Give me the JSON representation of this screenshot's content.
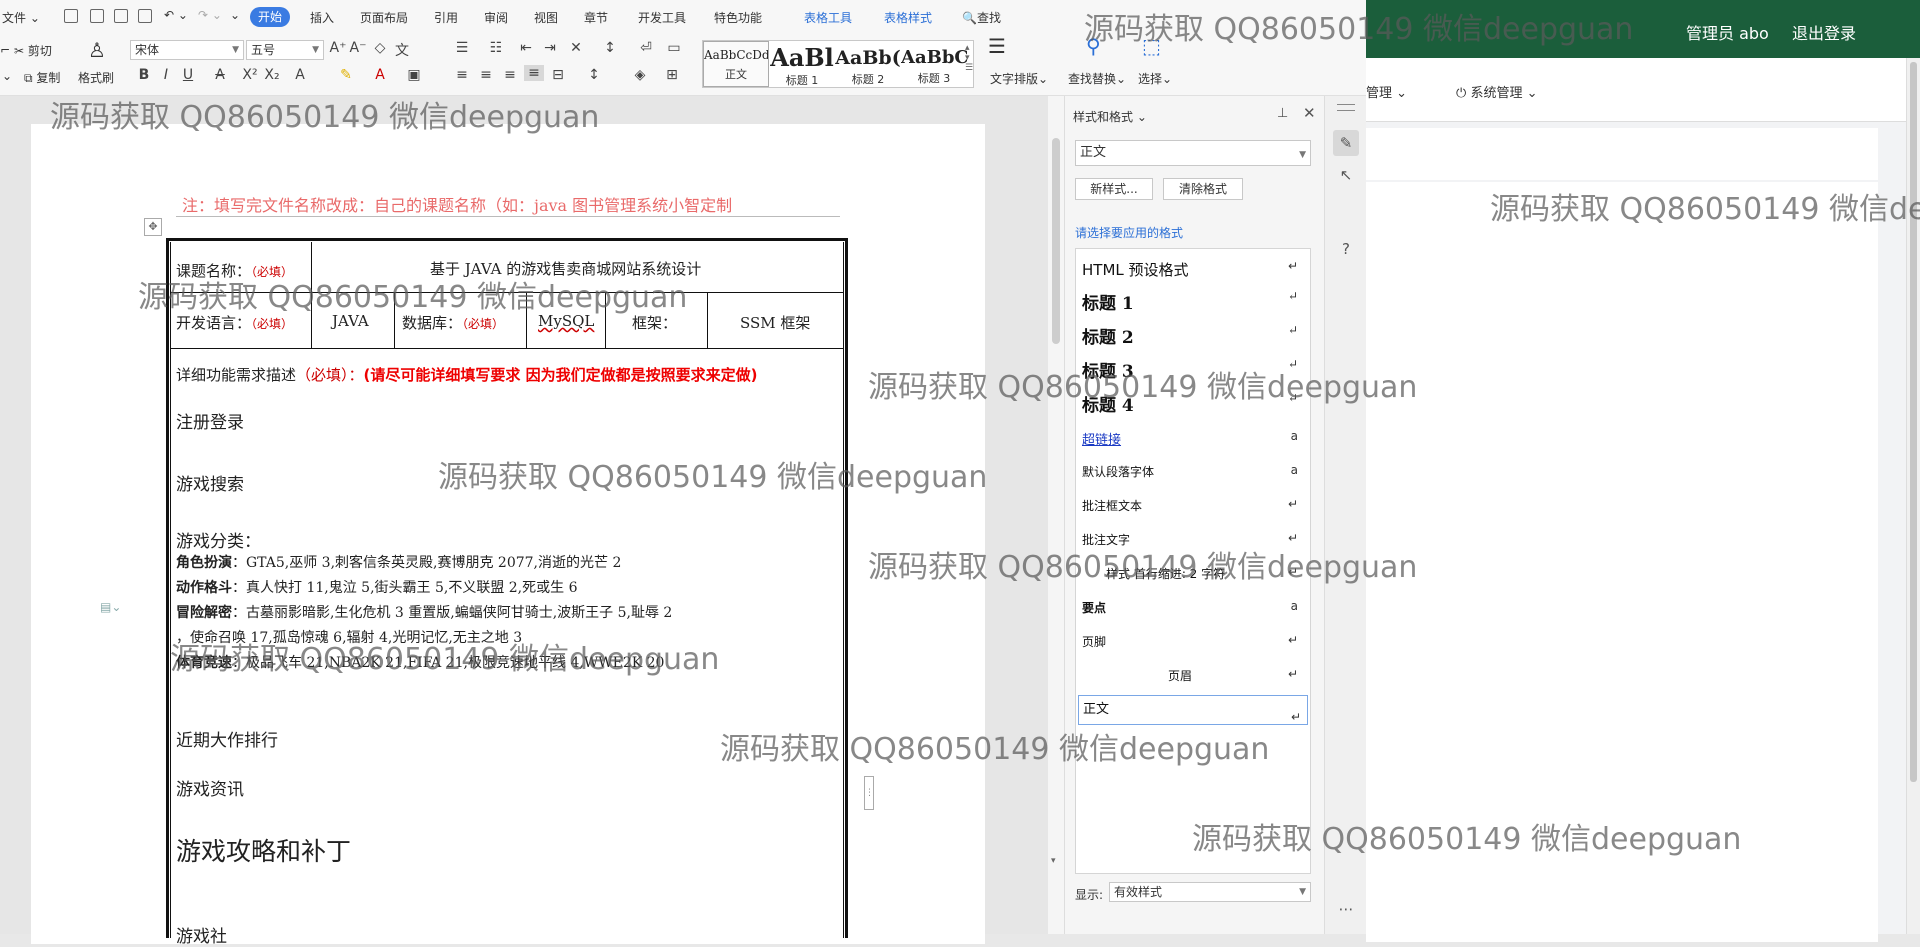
{
  "quick_access": {
    "file_label": "文件"
  },
  "ribbon_tabs": [
    "开始",
    "插入",
    "页面布局",
    "引用",
    "审阅",
    "视图",
    "章节",
    "开发工具",
    "特色功能",
    "表格工具",
    "表格样式"
  ],
  "search_label": "查找",
  "ribbon": {
    "cut": "剪切",
    "copy": "复制",
    "format_painter": "格式刷",
    "font_name": "宋体",
    "font_size": "五号",
    "styles": [
      {
        "preview": "AaBbCcDd",
        "label": "正文"
      },
      {
        "preview": "AaBl",
        "label": "标题 1"
      },
      {
        "preview": "AaBb(",
        "label": "标题 2"
      },
      {
        "preview": "AaBbC",
        "label": "标题 3"
      }
    ],
    "text_layout": "文字排版",
    "find_replace": "查找替换",
    "select": "选择"
  },
  "document": {
    "note": "注：填写完文件名称改成：自己的课题名称（如：java 图书管理系统小智定制",
    "table": {
      "topic_label": "课题名称：",
      "topic_required": "（必填）",
      "topic_value": "基于 JAVA 的游戏售卖商城网站系统设计",
      "lang_label": "开发语言：",
      "lang_required": "（必填）",
      "lang_value": "JAVA",
      "db_label": "数据库：",
      "db_required": "（必填）",
      "db_value": "MySQL",
      "framework_label": "框架：",
      "framework_value": "SSM 框架",
      "desc_label": "详细功能需求描述",
      "desc_required": "（必填）：",
      "desc_emphasis": "(请尽可能详细填写要求  因为我们定做都是按照要求来定做)"
    },
    "items": {
      "register": "注册登录",
      "search": "游戏搜索",
      "category": "游戏分类：",
      "rpg_label": "角色扮演",
      "rpg_value": "：GTA5,巫师 3,刺客信条英灵殿,赛博朋克 2077,消逝的光芒 2",
      "fight_label": "动作格斗",
      "fight_value": "：真人快打 11,鬼泣 5,街头霸王 5,不义联盟 2,死或生 6",
      "adv_label": "冒险解密",
      "adv_value": "：古墓丽影暗影,生化危机 3 重置版,蝙蝠侠阿甘骑士,波斯王子 5,耻辱 2",
      "adv_cont": "，使命召唤 17,孤岛惊魂 6,辐射 4,光明记忆,无主之地 3",
      "race_label": "体育竞速",
      "race_value": "：极品飞车 21,NBA2K 21,FIFA 21,极限竞速地平线 4,WWE2K 20",
      "ranking": "近期大作排行",
      "news": "游戏资讯",
      "guide": "游戏攻略和补丁",
      "partial": "游戏社"
    }
  },
  "styles_pane": {
    "title": "样式和格式",
    "current_style": "正文",
    "new_style": "新样式...",
    "clear_format": "清除格式",
    "choose_label": "请选择要应用的格式",
    "items": [
      "HTML  预设格式",
      "标题  1",
      "标题  2",
      "标题  3",
      "标题  4",
      "超链接",
      "默认段落字体",
      "批注框文本",
      "批注文字",
      "样式  首行缩进:   2 字符",
      "要点",
      "页脚",
      "页眉",
      "正文"
    ],
    "show_label": "显示:",
    "show_value": "有效样式"
  },
  "webapp": {
    "admin": "管理员 abo",
    "logout": "退出登录",
    "menu_manage": "管理",
    "menu_system": "系统管理"
  },
  "watermark": "源码获取 QQ86050149 微信deepguan",
  "colors": {
    "accent": "#3a7be2",
    "topbar": "#1b5e3b",
    "required_red": "#cc0000",
    "note_red": "#e96a6a"
  }
}
